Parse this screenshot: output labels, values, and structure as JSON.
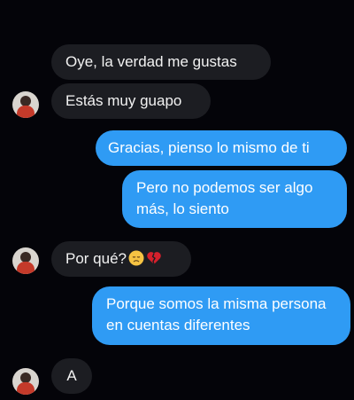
{
  "messages": [
    {
      "from": "them",
      "text": "Oye, la verdad me gustas"
    },
    {
      "from": "them",
      "text": "Estás muy guapo"
    },
    {
      "from": "me",
      "text": "Gracias, pienso lo mismo de ti"
    },
    {
      "from": "me",
      "text": "Pero no podemos ser algo más, lo siento"
    },
    {
      "from": "them",
      "text": "Por qué?",
      "emoji": [
        "disappointed-face-icon",
        "broken-heart-icon"
      ]
    },
    {
      "from": "me",
      "text": "Porque somos la misma persona en cuentas diferentes"
    },
    {
      "from": "them",
      "text": "A"
    }
  ],
  "colors": {
    "background": "#040409",
    "incoming_bubble": "#1c1d22",
    "outgoing_bubble": "#2f9bf4"
  }
}
